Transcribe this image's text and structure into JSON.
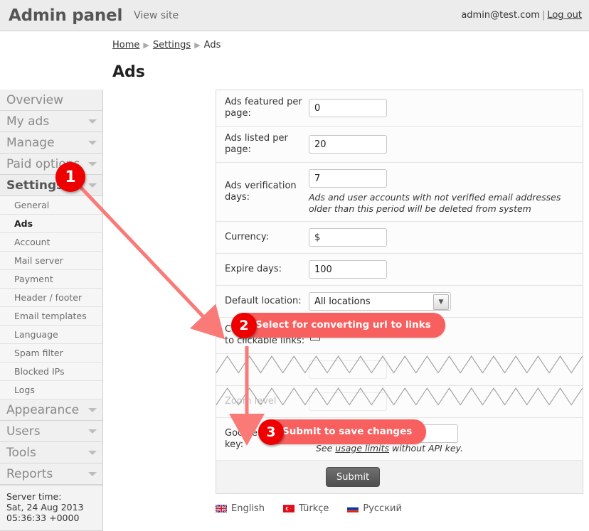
{
  "header": {
    "app_title": "Admin panel",
    "view_site": "View site",
    "user_email": "admin@test.com",
    "separator": "|",
    "logout": "Log out"
  },
  "sidebar": {
    "top_items": [
      {
        "label": "Overview",
        "caret": false,
        "active": false
      },
      {
        "label": "My ads",
        "caret": true,
        "active": false
      },
      {
        "label": "Manage",
        "caret": true,
        "active": false
      },
      {
        "label": "Paid options",
        "caret": true,
        "active": false
      },
      {
        "label": "Settings",
        "caret": true,
        "active": true
      }
    ],
    "sub_items": [
      {
        "label": "General",
        "active": false
      },
      {
        "label": "Ads",
        "active": true
      },
      {
        "label": "Account",
        "active": false
      },
      {
        "label": "Mail server",
        "active": false
      },
      {
        "label": "Payment",
        "active": false
      },
      {
        "label": "Header / footer",
        "active": false
      },
      {
        "label": "Email templates",
        "active": false
      },
      {
        "label": "Language",
        "active": false
      },
      {
        "label": "Spam filter",
        "active": false
      },
      {
        "label": "Blocked IPs",
        "active": false
      },
      {
        "label": "Logs",
        "active": false
      }
    ],
    "bottom_items": [
      {
        "label": "Appearance",
        "caret": true
      },
      {
        "label": "Users",
        "caret": true
      },
      {
        "label": "Tools",
        "caret": true
      },
      {
        "label": "Reports",
        "caret": true
      }
    ],
    "server_time": {
      "label": "Server time:",
      "date": "Sat, 24 Aug 2013",
      "time": "05:36:33 +0000"
    }
  },
  "breadcrumb": {
    "home": "Home",
    "settings": "Settings",
    "current": "Ads",
    "separator": "▶"
  },
  "page": {
    "title": "Ads"
  },
  "form": {
    "rows": [
      {
        "label": "Ads featured per page:",
        "value": "0"
      },
      {
        "label": "Ads listed per page:",
        "value": "20"
      },
      {
        "label": "Ads verification days:",
        "value": "7",
        "hint": "Ads and user accounts with not verified email addresses older than this period will be deleted from system"
      },
      {
        "label": "Currency:",
        "value": "$"
      },
      {
        "label": "Expire days:",
        "value": "100"
      }
    ],
    "default_location": {
      "label": "Default location:",
      "value": "All locations"
    },
    "convert_urls": {
      "label": "Convert text urls to clickable links:",
      "checked": true,
      "tick": "✔"
    },
    "obscured_rows": [
      {
        "label": "",
        "value": ""
      },
      {
        "label": "Zoom level",
        "value": ""
      }
    ],
    "google_maps": {
      "label": "Google maps API key:",
      "value": "",
      "note_before": "See ",
      "note_link": "usage limits",
      "note_after": " without API key."
    },
    "submit_label": "Submit"
  },
  "languages": [
    {
      "label": "English",
      "flag": "uk-flag-icon"
    },
    {
      "label": "Türkçe",
      "flag": "turkey-flag-icon"
    },
    {
      "label": "Русский",
      "flag": "russia-flag-icon"
    }
  ],
  "callouts": [
    {
      "number": "1",
      "text": ""
    },
    {
      "number": "2",
      "text": "Select for converting url to links"
    },
    {
      "number": "3",
      "text": "Submit to save changes"
    }
  ],
  "colors": {
    "badge_red": "#ef0000",
    "pill_red": "#f7605e",
    "arrow_red": "#f97a77",
    "topbar_bg": "#ececec",
    "sidebar_bg": "#f0f0f0"
  }
}
